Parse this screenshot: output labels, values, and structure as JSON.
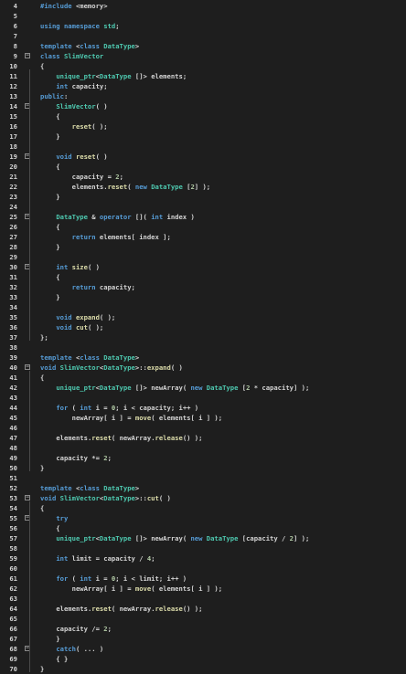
{
  "editor": {
    "language": "cpp",
    "lines": [
      {
        "n": "4",
        "text": "#include <memory>",
        "fold": false
      },
      {
        "n": "5",
        "text": "",
        "fold": false
      },
      {
        "n": "6",
        "text": "using namespace std;",
        "fold": false
      },
      {
        "n": "7",
        "text": "",
        "fold": false
      },
      {
        "n": "8",
        "text": "template <class DataType>",
        "fold": false
      },
      {
        "n": "9",
        "text": "class SlimVector",
        "fold": true
      },
      {
        "n": "10",
        "text": "{",
        "fold": false
      },
      {
        "n": "11",
        "text": "    unique_ptr<DataType []> elements;",
        "fold": false
      },
      {
        "n": "12",
        "text": "    int capacity;",
        "fold": false
      },
      {
        "n": "13",
        "text": "public:",
        "fold": false
      },
      {
        "n": "14",
        "text": "    SlimVector( )",
        "fold": true
      },
      {
        "n": "15",
        "text": "    {",
        "fold": false
      },
      {
        "n": "16",
        "text": "        reset( );",
        "fold": false
      },
      {
        "n": "17",
        "text": "    }",
        "fold": false
      },
      {
        "n": "18",
        "text": "",
        "fold": false
      },
      {
        "n": "19",
        "text": "    void reset( )",
        "fold": true
      },
      {
        "n": "20",
        "text": "    {",
        "fold": false
      },
      {
        "n": "21",
        "text": "        capacity = 2;",
        "fold": false
      },
      {
        "n": "22",
        "text": "        elements.reset( new DataType [2] );",
        "fold": false
      },
      {
        "n": "23",
        "text": "    }",
        "fold": false
      },
      {
        "n": "24",
        "text": "",
        "fold": false
      },
      {
        "n": "25",
        "text": "    DataType & operator []( int index )",
        "fold": true
      },
      {
        "n": "26",
        "text": "    {",
        "fold": false
      },
      {
        "n": "27",
        "text": "        return elements[ index ];",
        "fold": false
      },
      {
        "n": "28",
        "text": "    }",
        "fold": false
      },
      {
        "n": "29",
        "text": "",
        "fold": false
      },
      {
        "n": "30",
        "text": "    int size( )",
        "fold": true
      },
      {
        "n": "31",
        "text": "    {",
        "fold": false
      },
      {
        "n": "32",
        "text": "        return capacity;",
        "fold": false
      },
      {
        "n": "33",
        "text": "    }",
        "fold": false
      },
      {
        "n": "34",
        "text": "",
        "fold": false
      },
      {
        "n": "35",
        "text": "    void expand( );",
        "fold": false
      },
      {
        "n": "36",
        "text": "    void cut( );",
        "fold": false
      },
      {
        "n": "37",
        "text": "};",
        "fold": false
      },
      {
        "n": "38",
        "text": "",
        "fold": false
      },
      {
        "n": "39",
        "text": "template <class DataType>",
        "fold": false
      },
      {
        "n": "40",
        "text": "void SlimVector<DataType>::expand( )",
        "fold": true
      },
      {
        "n": "41",
        "text": "{",
        "fold": false
      },
      {
        "n": "42",
        "text": "    unique_ptr<DataType []> newArray( new DataType [2 * capacity] );",
        "fold": false
      },
      {
        "n": "43",
        "text": "",
        "fold": false
      },
      {
        "n": "44",
        "text": "    for ( int i = 0; i < capacity; i++ )",
        "fold": false
      },
      {
        "n": "45",
        "text": "        newArray[ i ] = move( elements[ i ] );",
        "fold": false
      },
      {
        "n": "46",
        "text": "",
        "fold": false
      },
      {
        "n": "47",
        "text": "    elements.reset( newArray.release() );",
        "fold": false
      },
      {
        "n": "48",
        "text": "",
        "fold": false
      },
      {
        "n": "49",
        "text": "    capacity *= 2;",
        "fold": false
      },
      {
        "n": "50",
        "text": "}",
        "fold": false
      },
      {
        "n": "51",
        "text": "",
        "fold": false
      },
      {
        "n": "52",
        "text": "template <class DataType>",
        "fold": false
      },
      {
        "n": "53",
        "text": "void SlimVector<DataType>::cut( )",
        "fold": true
      },
      {
        "n": "54",
        "text": "{",
        "fold": false
      },
      {
        "n": "55",
        "text": "    try",
        "fold": true
      },
      {
        "n": "56",
        "text": "    {",
        "fold": false
      },
      {
        "n": "57",
        "text": "    unique_ptr<DataType []> newArray( new DataType [capacity / 2] );",
        "fold": false
      },
      {
        "n": "58",
        "text": "",
        "fold": false
      },
      {
        "n": "59",
        "text": "    int limit = capacity / 4;",
        "fold": false
      },
      {
        "n": "60",
        "text": "",
        "fold": false
      },
      {
        "n": "61",
        "text": "    for ( int i = 0; i < limit; i++ )",
        "fold": false
      },
      {
        "n": "62",
        "text": "        newArray[ i ] = move( elements[ i ] );",
        "fold": false
      },
      {
        "n": "63",
        "text": "",
        "fold": false
      },
      {
        "n": "64",
        "text": "    elements.reset( newArray.release() );",
        "fold": false
      },
      {
        "n": "65",
        "text": "",
        "fold": false
      },
      {
        "n": "66",
        "text": "    capacity /= 2;",
        "fold": false
      },
      {
        "n": "67",
        "text": "    }",
        "fold": false
      },
      {
        "n": "68",
        "text": "    catch( ... )",
        "fold": true
      },
      {
        "n": "69",
        "text": "    { }",
        "fold": false
      },
      {
        "n": "70",
        "text": "}",
        "fold": false
      }
    ]
  },
  "colors": {
    "background": "#1e1e1e",
    "keyword": "#569cd6",
    "type": "#4ec9b0",
    "function": "#dcdcaa",
    "number": "#b5cea8",
    "plain": "#d4d4d4"
  }
}
